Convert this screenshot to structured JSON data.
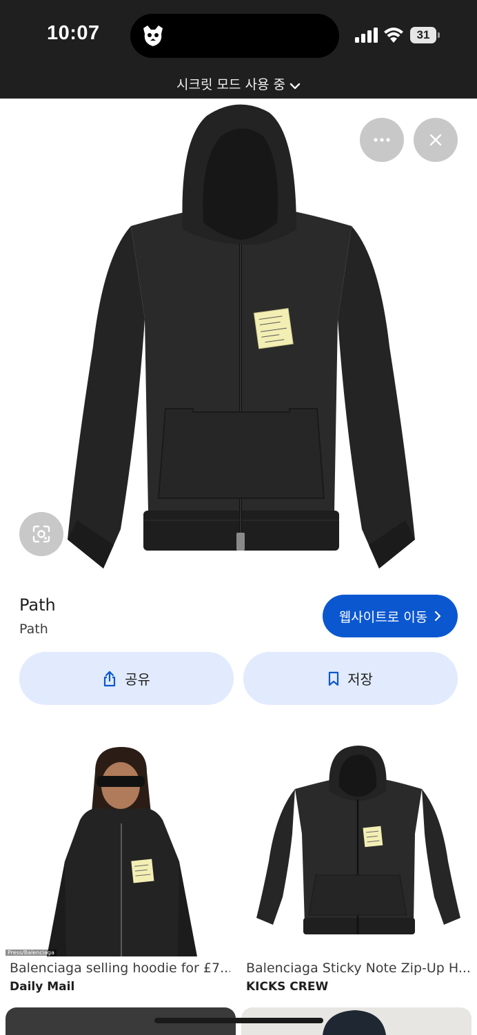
{
  "status_bar": {
    "time": "10:07",
    "battery": "31"
  },
  "incognito": {
    "label": "시크릿 모드 사용 중"
  },
  "result": {
    "title": "Path",
    "source": "Path"
  },
  "buttons": {
    "visit": "웹사이트로 이동",
    "share": "공유",
    "save": "저장"
  },
  "related": [
    {
      "title": "Balenciaga selling hoodie for £7...",
      "source": "Daily Mail",
      "credit": "Press/Balenciaga"
    },
    {
      "title": "Balenciaga Sticky Note Zip-Up H...",
      "source": "KICKS CREW"
    }
  ],
  "colors": {
    "statusbar": "#1f1f1f",
    "primary_button": "#0b57d0",
    "tonal_button": "#e1ebfd",
    "hoodie": "#262626",
    "sticky_note": "#f3efb4"
  },
  "icons": [
    "incognito-icon",
    "signal-icon",
    "wifi-icon",
    "chevron-down-icon",
    "more-icon",
    "close-icon",
    "lens-icon",
    "share-icon",
    "bookmark-icon",
    "chevron-right-icon"
  ]
}
